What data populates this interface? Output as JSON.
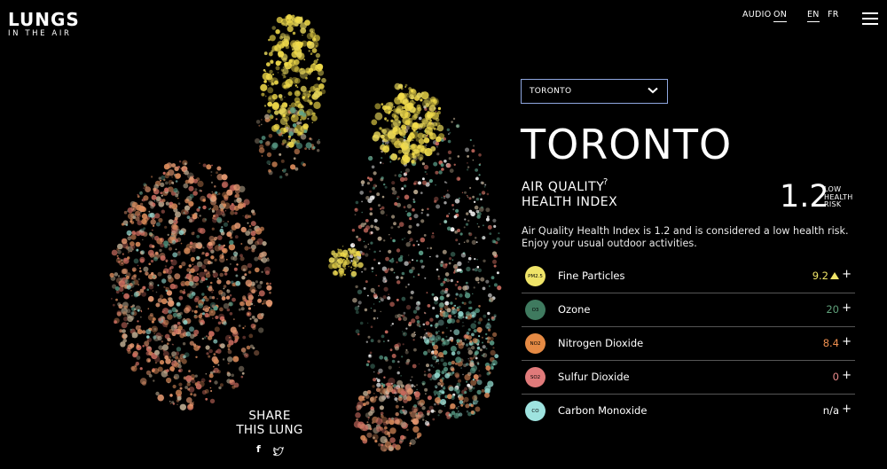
{
  "logo": {
    "line1": "LUNGS",
    "line2": "IN THE AIR"
  },
  "nav": {
    "audio_label": "AUDIO",
    "audio_state": "ON",
    "lang_en": "EN",
    "lang_fr": "FR"
  },
  "city_select": {
    "value": "TORONTO"
  },
  "city_title": "TORONTO",
  "aqhi": {
    "label_line1": "AIR QUALITY",
    "label_line2": "HEALTH INDEX",
    "help": "?",
    "value": "1.2",
    "risk_line1": "LOW",
    "risk_line2": "HEALTH",
    "risk_line3": "RISK"
  },
  "description": "Air Quality Health Index is 1.2 and is considered a low health risk. Enjoy your usual outdoor activities.",
  "pollutants": [
    {
      "code": "PM2.5",
      "name": "Fine Particles",
      "value": "9.2",
      "color": "#efe468",
      "value_color": "#efe468"
    },
    {
      "code": "O3",
      "name": "Ozone",
      "value": "20",
      "color": "#3f7a5f",
      "value_color": "#5fa07a"
    },
    {
      "code": "NO2",
      "name": "Nitrogen Dioxide",
      "value": "8.4",
      "color": "#e58a44",
      "value_color": "#f09050"
    },
    {
      "code": "SO2",
      "name": "Sulfur Dioxide",
      "value": "0",
      "color": "#e07a7a",
      "value_color": "#e98a8a"
    },
    {
      "code": "CO",
      "name": "Carbon Monoxide",
      "value": "n/a",
      "color": "#9ee3df",
      "value_color": "#ffffff"
    }
  ],
  "plus_label": "+",
  "share": {
    "line1": "SHARE",
    "line2": "THIS LUNG",
    "facebook_icon": "f",
    "twitter_icon": "twitter-bird"
  },
  "lung_palette": [
    "#f2dc4b",
    "#e3d35a",
    "#d98a5a",
    "#c86b5e",
    "#e79a72",
    "#5ca08a",
    "#8fd2c9",
    "#ffffff",
    "#b6a48b"
  ]
}
